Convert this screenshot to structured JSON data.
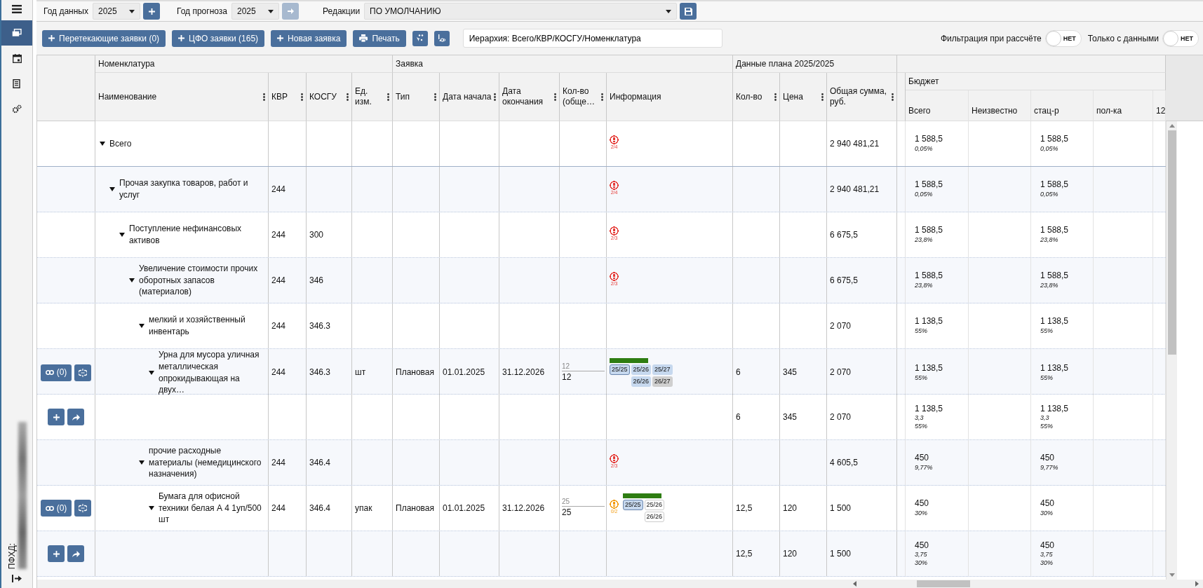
{
  "toolbar": {
    "data_year": {
      "label": "Год данных",
      "value": "2025"
    },
    "forecast_year": {
      "label": "Год прогноза",
      "value": "2025",
      "next_disabled": true
    },
    "edition": {
      "label": "Редакции",
      "value": "ПО УМОЛЧАНИЮ"
    }
  },
  "actions": {
    "buttons": [
      {
        "kind": "add",
        "label": "Перетекающие заявки (0)"
      },
      {
        "kind": "add",
        "label": "ЦФО заявки (165)"
      },
      {
        "kind": "add",
        "label": "Новая заявка"
      },
      {
        "kind": "print",
        "label": "Печать"
      }
    ],
    "hierarchy": "Иерархия: Всего/КВР/КОСГУ/Номенклатура",
    "toggles": [
      {
        "label": "Фильтрация при рассчёте",
        "on": false,
        "state_text": "НЕТ"
      },
      {
        "label": "Только с данными",
        "on": false,
        "state_text": "НЕТ"
      }
    ]
  },
  "sidebar": {
    "items": [
      {
        "kind": "windows",
        "selected": true
      },
      {
        "kind": "calendar",
        "selected": false
      },
      {
        "kind": "document",
        "selected": false
      },
      {
        "kind": "settings",
        "selected": false
      }
    ],
    "footer_label": "ПФХД:"
  },
  "table": {
    "groups": [
      "Номенклатура",
      "Заявка",
      "Данные плана 2025/2025"
    ],
    "columns": [
      {
        "label": "Наименование",
        "menu": true
      },
      {
        "label": "КВР",
        "menu": true
      },
      {
        "label": "КОСГУ",
        "menu": true
      },
      {
        "label": "Ед. изм.",
        "menu": true
      },
      {
        "label": "Тип",
        "menu": true
      },
      {
        "label": "Дата начала",
        "menu": true
      },
      {
        "label": "Дата окончания",
        "menu": true
      },
      {
        "label": "Кол-во (обще…",
        "menu": true
      },
      {
        "label": "Информация",
        "menu": false
      },
      {
        "label": "Кол-во",
        "menu": true
      },
      {
        "label": "Цена",
        "menu": true
      },
      {
        "label": "Общая сумма, руб.",
        "menu": true
      }
    ],
    "budget_group": "Бюджет",
    "budget_columns": [
      "Всего",
      "Неизвестно",
      "стац-р",
      "пол-ка",
      "12"
    ],
    "rows": [
      {
        "kind": "group",
        "name": "Всего",
        "expanded": true,
        "info": {
          "warning": {
            "color": "#e53935",
            "count": "2/4"
          }
        },
        "sum": "2 940 481,21",
        "budget": {
          "total": {
            "value": "1 588,5",
            "notes": [
              "0,05%"
            ]
          },
          "stac_r": {
            "value": "1 588,5",
            "notes": [
              "0,05%"
            ]
          }
        },
        "children": [
          {
            "kind": "group",
            "name": "Прочая закупка товаров, работ и услуг",
            "expanded": true,
            "kvr": "244",
            "info": {
              "warning": {
                "color": "#e53935",
                "count": "2/4"
              }
            },
            "sum": "2 940 481,21",
            "budget": {
              "total": {
                "value": "1 588,5",
                "notes": [
                  "0,05%"
                ]
              },
              "stac_r": {
                "value": "1 588,5",
                "notes": [
                  "0,05%"
                ]
              }
            },
            "children": [
              {
                "kind": "group",
                "name": "Поступление нефинансовых активов",
                "expanded": true,
                "kvr": "244",
                "kosgu": "300",
                "info": {
                  "warning": {
                    "color": "#e53935",
                    "count": "2/3"
                  }
                },
                "sum": "6 675,5",
                "budget": {
                  "total": {
                    "value": "1 588,5",
                    "notes": [
                      "23,8%"
                    ]
                  },
                  "stac_r": {
                    "value": "1 588,5",
                    "notes": [
                      "23,8%"
                    ]
                  }
                },
                "children": [
                  {
                    "kind": "group",
                    "name": "Увеличение стоимости прочих оборотных запасов (материалов)",
                    "expanded": true,
                    "kvr": "244",
                    "kosgu": "346",
                    "info": {
                      "warning": {
                        "color": "#e53935",
                        "count": "2/3"
                      }
                    },
                    "sum": "6 675,5",
                    "budget": {
                      "total": {
                        "value": "1 588,5",
                        "notes": [
                          "23,8%"
                        ]
                      },
                      "stac_r": {
                        "value": "1 588,5",
                        "notes": [
                          "23,8%"
                        ]
                      }
                    },
                    "children": [
                      {
                        "kind": "group",
                        "name": "мелкий и хозяйственный инвентарь",
                        "expanded": true,
                        "kvr": "244",
                        "kosgu": "346.3",
                        "sum": "2 070",
                        "budget": {
                          "total": {
                            "value": "1 138,5",
                            "notes": [
                              "55%"
                            ]
                          },
                          "stac_r": {
                            "value": "1 138,5",
                            "notes": [
                              "55%"
                            ]
                          }
                        },
                        "children": [
                          {
                            "kind": "item",
                            "name": "Урна для мусора уличная металлическая опрокидывающая на двух…",
                            "expanded": true,
                            "links": "(0)",
                            "kvr": "244",
                            "kosgu": "346.3",
                            "unit": "шт",
                            "type": "Плановая",
                            "start": "01.01.2025",
                            "end": "31.12.2026",
                            "qty": {
                              "planned": "12",
                              "value": "12"
                            },
                            "info": {
                              "level": 1,
                              "chip_rows": [
                                [
                                  {
                                    "label": "25/25",
                                    "kind": "current"
                                  },
                                  {
                                    "label": "25/26",
                                    "kind": "planned"
                                  },
                                  {
                                    "label": "25/27",
                                    "kind": "planned"
                                  }
                                ],
                                [
                                  {
                                    "label": "26/26",
                                    "kind": "planned"
                                  },
                                  {
                                    "label": "26/27",
                                    "kind": "closed"
                                  }
                                ]
                              ]
                            },
                            "plan_qty": "6",
                            "price": "345",
                            "sum": "2 070",
                            "budget": {
                              "total": {
                                "value": "1 138,5",
                                "notes": [
                                  "55%"
                                ]
                              },
                              "stac_r": {
                                "value": "1 138,5",
                                "notes": [
                                  "55%"
                                ]
                              }
                            },
                            "children": [
                              {
                                "kind": "plan",
                                "plan_qty": "6",
                                "price": "345",
                                "sum": "2 070",
                                "budget": {
                                  "total": {
                                    "value": "1 138,5",
                                    "notes": [
                                      "3,3",
                                      "55%"
                                    ]
                                  },
                                  "stac_r": {
                                    "value": "1 138,5",
                                    "notes": [
                                      "3,3",
                                      "55%"
                                    ]
                                  }
                                }
                              }
                            ]
                          }
                        ]
                      },
                      {
                        "kind": "group",
                        "name": "прочие расходные материалы (немедицинского назначения)",
                        "expanded": true,
                        "kvr": "244",
                        "kosgu": "346.4",
                        "info": {
                          "warning": {
                            "color": "#e53935",
                            "count": "2/3"
                          }
                        },
                        "sum": "4 605,5",
                        "budget": {
                          "total": {
                            "value": "450",
                            "notes": [
                              "9,77%"
                            ]
                          },
                          "stac_r": {
                            "value": "450",
                            "notes": [
                              "9,77%"
                            ]
                          }
                        },
                        "children": [
                          {
                            "kind": "item",
                            "name": "Бумага для офисной техники белая А 4 1уп/500 шт",
                            "expanded": true,
                            "links": "(0)",
                            "kvr": "244",
                            "kosgu": "346.4",
                            "unit": "упак",
                            "type": "Плановая",
                            "start": "01.01.2025",
                            "end": "31.12.2026",
                            "qty": {
                              "planned": "25",
                              "value": "25"
                            },
                            "info": {
                              "warning": {
                                "color": "#f39c12",
                                "count": "0/2"
                              },
                              "level": 1,
                              "chip_rows": [
                                [
                                  {
                                    "label": "25/25",
                                    "kind": "current"
                                  },
                                  {
                                    "label": "25/26",
                                    "kind": "empty"
                                  }
                                ],
                                [
                                  {
                                    "label": "26/26",
                                    "kind": "empty"
                                  }
                                ]
                              ]
                            },
                            "plan_qty": "12,5",
                            "price": "120",
                            "sum": "1 500",
                            "budget": {
                              "total": {
                                "value": "450",
                                "notes": [
                                  "30%"
                                ]
                              },
                              "stac_r": {
                                "value": "450",
                                "notes": [
                                  "30%"
                                ]
                              }
                            },
                            "children": [
                              {
                                "kind": "plan",
                                "plan_qty": "12,5",
                                "price": "120",
                                "sum": "1 500",
                                "budget": {
                                  "total": {
                                    "value": "450",
                                    "notes": [
                                      "3,75",
                                      "30%"
                                    ]
                                  },
                                  "stac_r": {
                                    "value": "450",
                                    "notes": [
                                      "3,75",
                                      "30%"
                                    ]
                                  }
                                }
                              }
                            ]
                          }
                        ]
                      }
                    ]
                  }
                ]
              }
            ]
          }
        ]
      }
    ]
  }
}
